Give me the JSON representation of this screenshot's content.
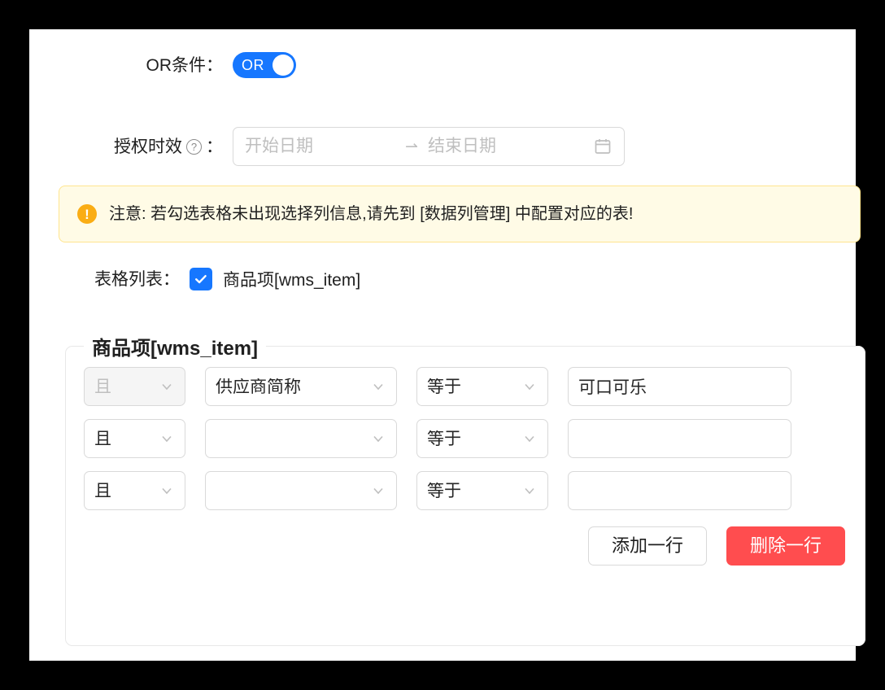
{
  "or_condition": {
    "label": "OR条件：",
    "switch_text": "OR",
    "checked": true
  },
  "auth_period": {
    "label": "授权时效",
    "help_icon": "question-circle-icon",
    "colon": "：",
    "start_placeholder": "开始日期",
    "start_value": "",
    "separator": "⇀",
    "end_placeholder": "结束日期",
    "end_value": "",
    "calendar_icon": "calendar-icon"
  },
  "alert": {
    "icon": "exclamation-circle-icon",
    "icon_glyph": "!",
    "text": "注意: 若勾选表格未出现选择列信息,请先到 [数据列管理] 中配置对应的表!"
  },
  "table_list": {
    "label": "表格列表：",
    "options": [
      {
        "label": "商品项[wms_item]",
        "checked": true
      }
    ]
  },
  "condition_group": {
    "legend": "商品项[wms_item]",
    "rows": [
      {
        "logic": "且",
        "logic_disabled": true,
        "field": "供应商简称",
        "field_placeholder": "",
        "operator": "等于",
        "value": "可口可乐",
        "value_placeholder": ""
      },
      {
        "logic": "且",
        "logic_disabled": false,
        "field": "",
        "field_placeholder": "",
        "operator": "等于",
        "value": "",
        "value_placeholder": ""
      },
      {
        "logic": "且",
        "logic_disabled": false,
        "field": "",
        "field_placeholder": "",
        "operator": "等于",
        "value": "",
        "value_placeholder": ""
      }
    ],
    "add_row_label": "添加一行",
    "delete_row_label": "删除一行"
  },
  "colors": {
    "primary": "#1677ff",
    "danger": "#ff4d4f",
    "warning_bg": "#fffbe6",
    "warning_border": "#ffe58f",
    "warning_icon": "#faad14",
    "border": "#d9d9d9"
  }
}
